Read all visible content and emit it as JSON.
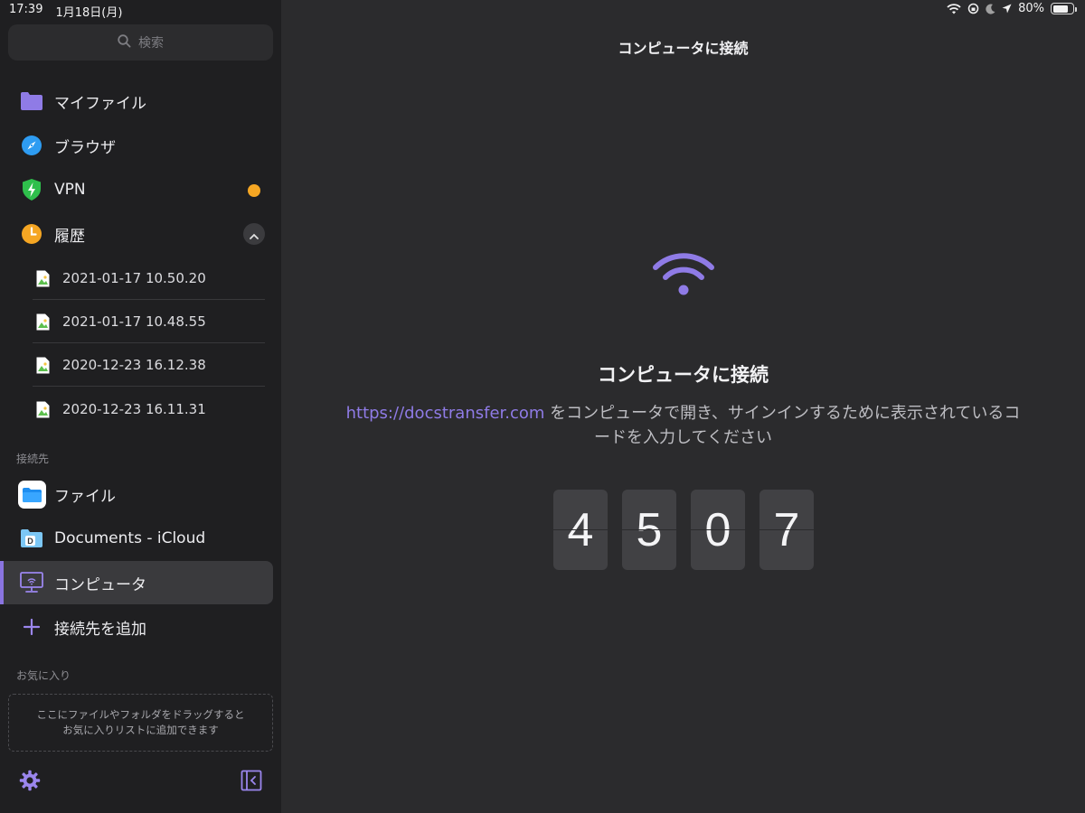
{
  "status_bar": {
    "time": "17:39",
    "date": "1月18日(月)",
    "battery": "80%",
    "battery_level": 0.8
  },
  "sidebar": {
    "search_placeholder": "検索",
    "items": [
      {
        "label": "マイファイル",
        "icon": "folder-icon"
      },
      {
        "label": "ブラウザ",
        "icon": "compass-icon"
      },
      {
        "label": "VPN",
        "icon": "shield-icon"
      },
      {
        "label": "履歴",
        "icon": "clock-icon"
      }
    ],
    "history": [
      "2021-01-17 10.50.20",
      "2021-01-17 10.48.55",
      "2020-12-23 16.12.38",
      "2020-12-23 16.11.31"
    ],
    "connections_title": "接続先",
    "connections": [
      {
        "label": "ファイル",
        "icon": "files-app-icon"
      },
      {
        "label": "Documents - iCloud",
        "icon": "documents-folder-icon"
      },
      {
        "label": "コンピュータ",
        "icon": "computer-icon"
      },
      {
        "label": "接続先を追加",
        "icon": "plus-icon"
      }
    ],
    "favorites_title": "お気に入り",
    "favorites_hint_line1": "ここにファイルやフォルダをドラッグすると",
    "favorites_hint_line2": "お気に入りリストに追加できます"
  },
  "main": {
    "title": "コンピュータに接続",
    "heading": "コンピュータに接続",
    "link": "https://docstransfer.com",
    "desc_line1_rest": " をコンピュータで開き、サインインするために表示されているコ",
    "desc_line2": "ードを入力してください",
    "code": [
      "4",
      "5",
      "0",
      "7"
    ]
  },
  "colors": {
    "accent": "#8a74e0",
    "sidebar_bg": "#1f1f21",
    "main_bg": "#2b2b2d",
    "vpn_status": "#f5a623"
  }
}
